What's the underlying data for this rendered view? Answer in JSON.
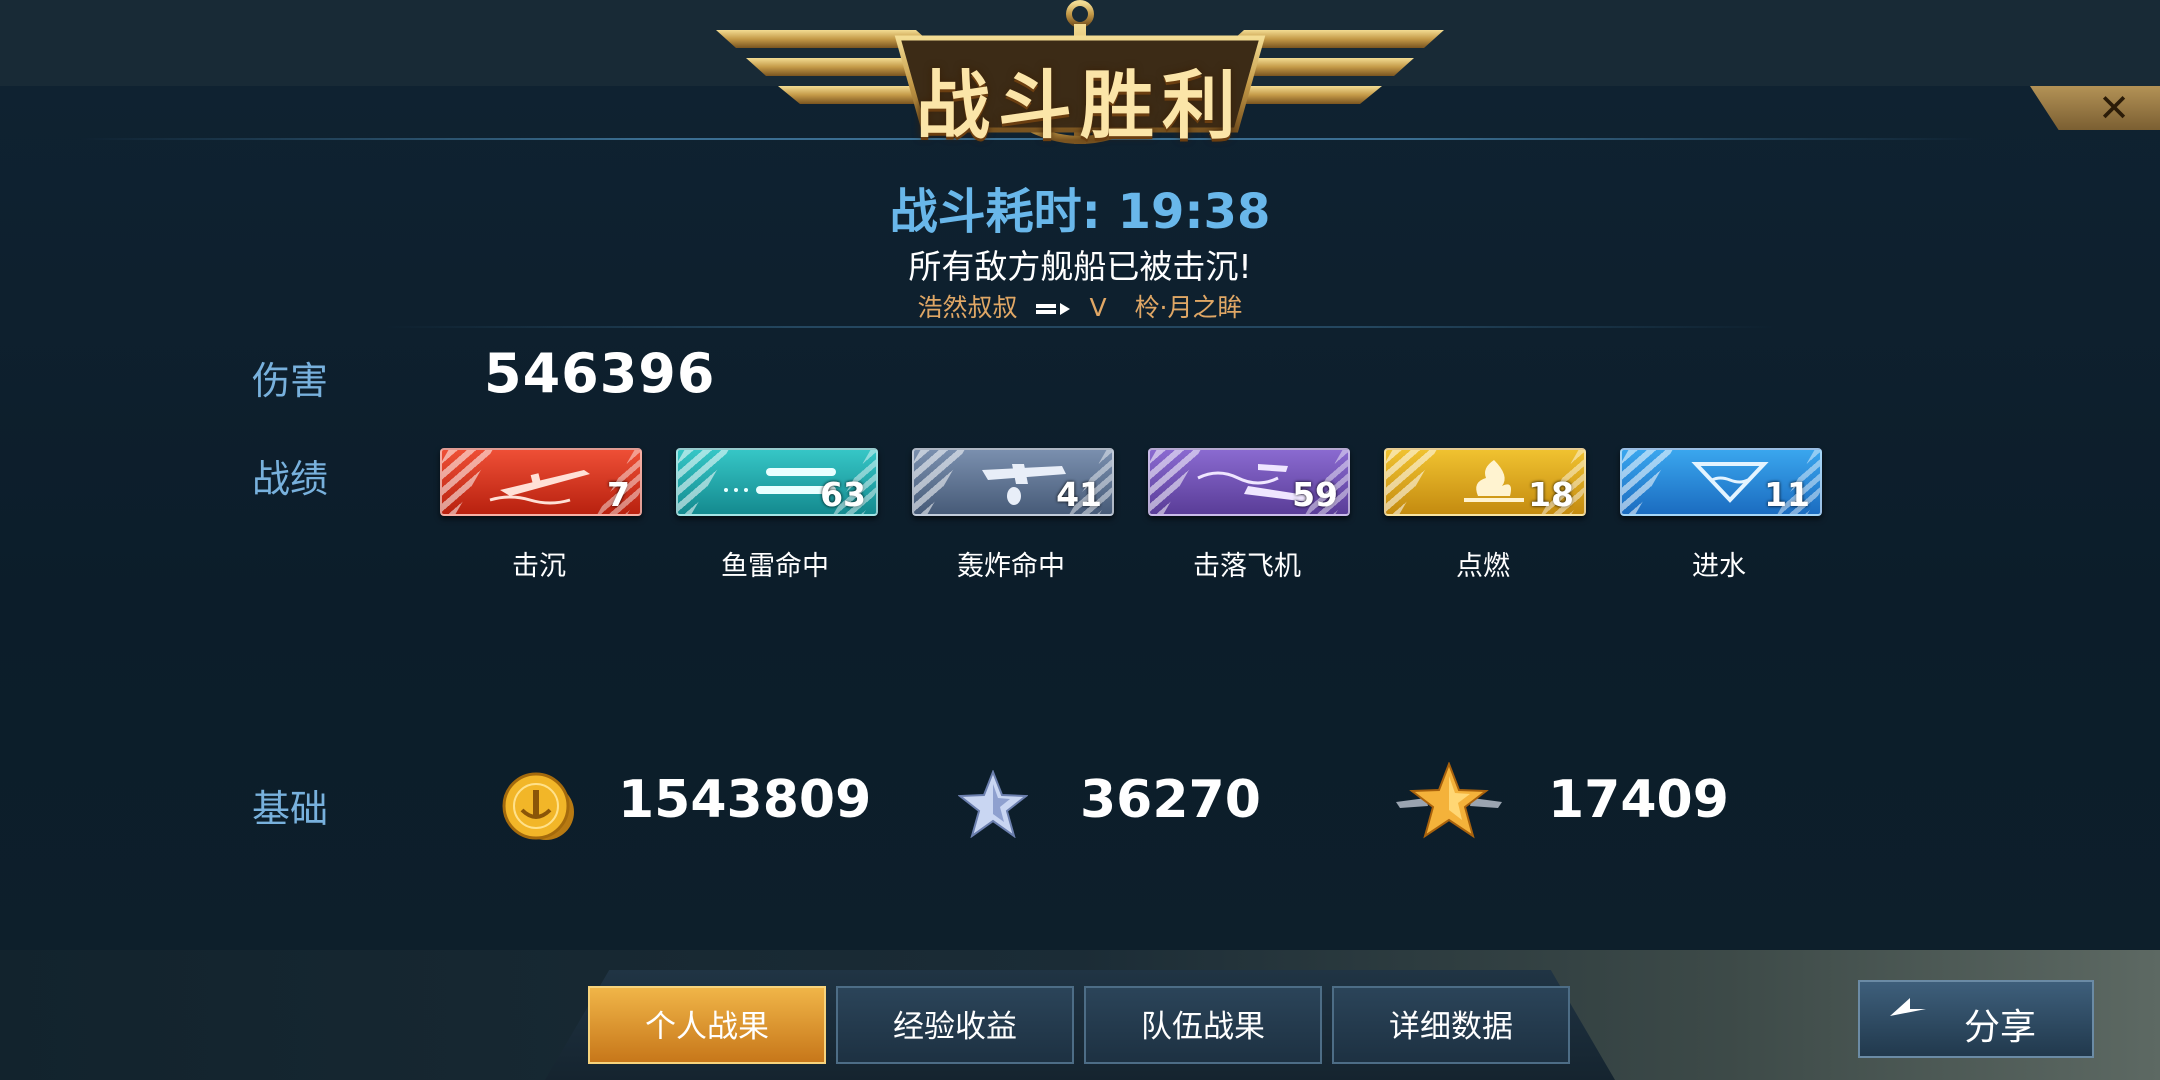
{
  "header": {
    "title": "战斗胜利",
    "close_symbol": "✕"
  },
  "battle": {
    "duration_label": "战斗耗时",
    "duration_value": "19:38",
    "result_message": "所有敌方舰船已被击沉!",
    "kill_feed": {
      "killer": "浩然叔叔",
      "separator": "V",
      "victim": "柃·月之眸"
    }
  },
  "damage": {
    "label": "伤害",
    "value": "546396"
  },
  "record": {
    "label": "战绩",
    "stats": [
      {
        "label": "击沉",
        "value": "7",
        "color": "#d8301f",
        "icon": "sinking-ship-icon"
      },
      {
        "label": "鱼雷命中",
        "value": "63",
        "color": "#1fa7a9",
        "icon": "torpedo-icon"
      },
      {
        "label": "轰炸命中",
        "value": "41",
        "color": "#5b7394",
        "icon": "bomber-icon"
      },
      {
        "label": "击落飞机",
        "value": "59",
        "color": "#6a4fb0",
        "icon": "shot-down-plane-icon"
      },
      {
        "label": "点燃",
        "value": "18",
        "color": "#d8a018",
        "icon": "fire-icon"
      },
      {
        "label": "进水",
        "value": "11",
        "color": "#2c8ad8",
        "icon": "flooding-icon"
      }
    ]
  },
  "base": {
    "label": "基础",
    "items": [
      {
        "icon": "gold-coin-icon",
        "value": "1543809"
      },
      {
        "icon": "silver-star-icon",
        "value": "36270"
      },
      {
        "icon": "gold-star-wings-icon",
        "value": "17409"
      }
    ]
  },
  "tabs": [
    {
      "label": "个人战果",
      "active": true
    },
    {
      "label": "经验收益",
      "active": false
    },
    {
      "label": "队伍战果",
      "active": false
    },
    {
      "label": "详细数据",
      "active": false
    }
  ],
  "share": {
    "label": "分享"
  }
}
